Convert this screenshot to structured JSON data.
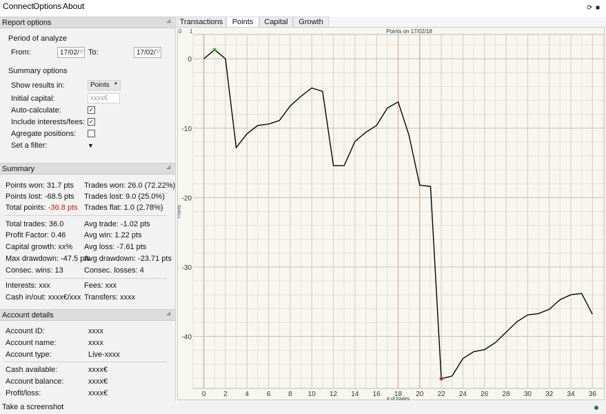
{
  "menu": {
    "items": [
      "Connect",
      "Options",
      "About"
    ]
  },
  "tray_icons": [
    "refresh-icon",
    "camera-icon"
  ],
  "report_options": {
    "header": "Report options",
    "period_label": "Period of analyze",
    "from_label": "From:",
    "from_value": "17/02/",
    "to_label": "To:",
    "to_value": "17/02/",
    "summary_options_label": "Summary options",
    "show_results_label": "Show results in:",
    "show_results_value": "Points",
    "initial_capital_label": "Initial capital:",
    "initial_capital_placeholder": "xxxx€",
    "auto_calc_label": "Auto-calculate:",
    "auto_calc_checked": true,
    "include_fees_label": "Include interests/fees:",
    "include_fees_checked": true,
    "aggregate_label": "Agregate positions:",
    "aggregate_checked": false,
    "filter_label": "Set a filter:"
  },
  "summary": {
    "header": "Summary",
    "points_won": "Points won: 31.7 pts",
    "trades_won": "Trades won: 26.0 (72.22%)",
    "points_lost": "Points lost: -68.5 pts",
    "trades_lost": "Trades lost: 9.0 (25.0%)",
    "total_points_label": "Total points: ",
    "total_points_value": "-36.8 pts",
    "trades_flat": "Trades flat: 1.0 (2.78%)",
    "total_trades": "Total trades: 36.0",
    "avg_trade": "Avg trade: -1.02 pts",
    "profit_factor": "Profit Factor: 0.46",
    "avg_win": "Avg win: 1.22 pts",
    "capital_growth": "Capital growth: xx%",
    "avg_loss": "Avg loss: -7.61 pts",
    "max_drawdown": "Max drawdown: -47.5 pts",
    "avg_drawdown": "Avg drawdown: -23.71 pts",
    "consec_wins": "Consec. wins: 13",
    "consec_losses": "Consec. losses: 4",
    "interests": "Interests: xxx",
    "fees": "Fees: xxx",
    "cash_inout": "Cash in/out: xxxx€/xxx",
    "transfers": "Transfers: xxxx"
  },
  "account": {
    "header": "Account details",
    "id_label": "Account ID:",
    "id_value": "xxxx",
    "name_label": "Account name:",
    "name_value": "xxxx",
    "type_label": "Account type:",
    "type_value": "Live-xxxx",
    "cash_label": "Cash available:",
    "cash_value": "xxxx€",
    "balance_label": "Account balance:",
    "balance_value": "xxxx€",
    "pl_label": "Profit/loss:",
    "pl_value": "xxxx€"
  },
  "tabs": [
    "Transactions",
    "Points",
    "Capital",
    "Growth"
  ],
  "active_tab": "Points",
  "status": {
    "text": "Take a screenshot",
    "indicator_color": "#1a7a60"
  },
  "chart_data": {
    "type": "line",
    "title": "Points on 17/02/18",
    "xlabel": "# of trades",
    "ylabel": "Points",
    "xlim": [
      -1,
      37
    ],
    "ylim": [
      -47.5,
      3.5
    ],
    "xticks": [
      0,
      2,
      4,
      6,
      8,
      10,
      12,
      14,
      16,
      18,
      20,
      22,
      24,
      26,
      28,
      30,
      32,
      34,
      36
    ],
    "yticks": [
      0,
      -10,
      -20,
      -30,
      -40
    ],
    "ytick_labels": [
      "0",
      "-10",
      "-20",
      "-30",
      "-40"
    ],
    "top_axis_ticks": [
      "0",
      "1"
    ],
    "grid": true,
    "line_color": "#000000",
    "max_marker_color": "#22bb22",
    "min_marker_color": "#cc2222",
    "vertical_markers": [
      18,
      20
    ],
    "vertical_marker_color": "#d89a9a",
    "x": [
      0,
      1,
      2,
      3,
      4,
      5,
      6,
      7,
      8,
      9,
      10,
      11,
      12,
      13,
      14,
      15,
      16,
      17,
      18,
      19,
      20,
      21,
      22,
      23,
      24,
      25,
      26,
      27,
      28,
      29,
      30,
      31,
      32,
      33,
      34,
      35,
      36
    ],
    "values": [
      0,
      1.3,
      0,
      -12.8,
      -10.8,
      -9.6,
      -9.4,
      -8.9,
      -6.8,
      -5.4,
      -4.2,
      -4.7,
      -15.4,
      -15.4,
      -11.9,
      -10.6,
      -9.6,
      -7.1,
      -6.2,
      -11,
      -18.2,
      -18.4,
      -46.1,
      -45.7,
      -43.2,
      -42.2,
      -41.9,
      -40.9,
      -39.4,
      -37.9,
      -36.9,
      -36.7,
      -36.1,
      -34.7,
      -34,
      -33.8,
      -36.8
    ],
    "max_marker": {
      "x": 1,
      "y": 1.3
    },
    "min_marker": {
      "x": 22,
      "y": -46.1
    }
  }
}
